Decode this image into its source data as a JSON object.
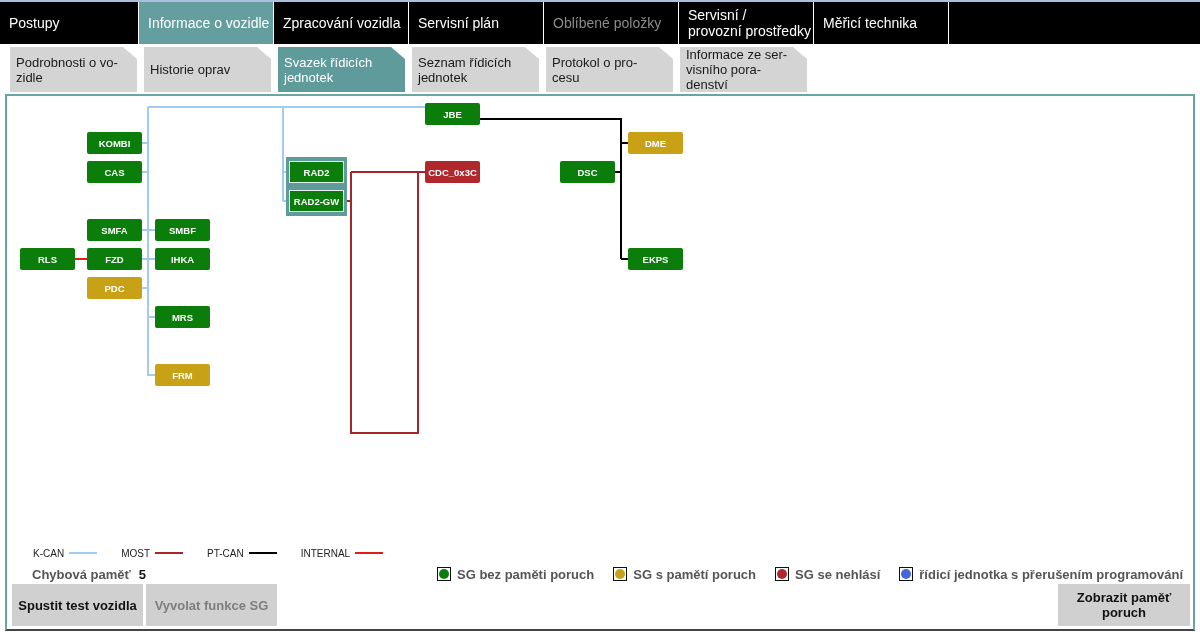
{
  "main_tabs": [
    {
      "label": "Postupy",
      "selected": false,
      "disabled": false
    },
    {
      "label": "Informace o vozidle",
      "selected": true,
      "disabled": false
    },
    {
      "label": "Zpracování vozidla",
      "selected": false,
      "disabled": false
    },
    {
      "label": "Servisní plán",
      "selected": false,
      "disabled": false
    },
    {
      "label": "Oblíbené položky",
      "selected": false,
      "disabled": true
    },
    {
      "label": "Servisní /\nprovozní prostředky",
      "selected": false,
      "disabled": false
    },
    {
      "label": "Měřicí technika",
      "selected": false,
      "disabled": false
    }
  ],
  "sub_tabs": [
    {
      "label": "Podrobnosti o vo-zidle",
      "selected": false
    },
    {
      "label": "Historie oprav",
      "selected": false
    },
    {
      "label": "Svazek řídicích jednotek",
      "selected": true
    },
    {
      "label": "Seznam řídicích jednotek",
      "selected": false
    },
    {
      "label": "Protokol o pro-cesu",
      "selected": false
    },
    {
      "label": "Informace ze ser-visního pora-denství",
      "selected": false
    }
  ],
  "diagram": {
    "nodes": [
      {
        "label": "JBE",
        "color": "#0b7d0b",
        "selected": false
      },
      {
        "label": "KOMBI",
        "color": "#0b7d0b",
        "selected": false
      },
      {
        "label": "DME",
        "color": "#c9a116",
        "selected": false
      },
      {
        "label": "CAS",
        "color": "#0b7d0b",
        "selected": false
      },
      {
        "label": "RAD2",
        "color": "#0b7d0b",
        "selected": true
      },
      {
        "label": "CDC_0x3C",
        "color": "#b0282c",
        "selected": false
      },
      {
        "label": "DSC",
        "color": "#0b7d0b",
        "selected": false
      },
      {
        "label": "RAD2-GW",
        "color": "#0b7d0b",
        "selected": true
      },
      {
        "label": "SMFA",
        "color": "#0b7d0b",
        "selected": false
      },
      {
        "label": "SMBF",
        "color": "#0b7d0b",
        "selected": false
      },
      {
        "label": "RLS",
        "color": "#0b7d0b",
        "selected": false
      },
      {
        "label": "FZD",
        "color": "#0b7d0b",
        "selected": false
      },
      {
        "label": "IHKA",
        "color": "#0b7d0b",
        "selected": false
      },
      {
        "label": "EKPS",
        "color": "#0b7d0b",
        "selected": false
      },
      {
        "label": "PDC",
        "color": "#c9a116",
        "selected": false
      },
      {
        "label": "MRS",
        "color": "#0b7d0b",
        "selected": false
      },
      {
        "label": "FRM",
        "color": "#c9a116",
        "selected": false
      }
    ]
  },
  "bus_legend": [
    {
      "label": "K-CAN",
      "color": "#a3cbef"
    },
    {
      "label": "MOST",
      "color": "#a8262a"
    },
    {
      "label": "PT-CAN",
      "color": "#000000"
    },
    {
      "label": "INTERNAL",
      "color": "#e01b1b"
    }
  ],
  "error_memory": {
    "label": "Chybová paměť",
    "count": "5"
  },
  "status_legend": [
    {
      "label": "SG bez paměti poruch",
      "color": "#0b7d0b"
    },
    {
      "label": "SG s pamětí poruch",
      "color": "#c9a116"
    },
    {
      "label": "SG se nehlásí",
      "color": "#b0282c"
    },
    {
      "label": "řídicí jednotka s přerušením programování",
      "color": "#4466d8"
    }
  ],
  "buttons": [
    {
      "label": "Spustit test vozidla",
      "disabled": false
    },
    {
      "label": "Vyvolat funkce SG",
      "disabled": true
    },
    {
      "label": "Zobrazit paměť poruch",
      "disabled": false
    }
  ]
}
